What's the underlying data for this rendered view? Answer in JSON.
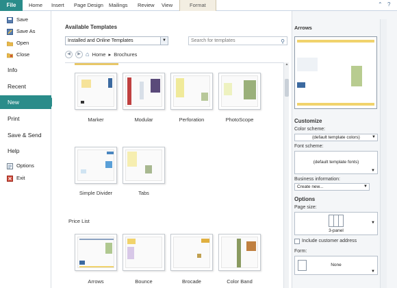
{
  "ribbon": {
    "file": "File",
    "tabs": [
      "Home",
      "Insert",
      "Page Design",
      "Mailings",
      "Review",
      "View"
    ],
    "format": "Format"
  },
  "backstage": {
    "items": [
      {
        "label": "Save",
        "icon": "save-icon"
      },
      {
        "label": "Save As",
        "icon": "save-as-icon"
      },
      {
        "label": "Open",
        "icon": "open-folder-icon"
      },
      {
        "label": "Close",
        "icon": "close-document-icon"
      }
    ],
    "sections": [
      "Info",
      "Recent",
      "New",
      "Print",
      "Save & Send",
      "Help"
    ],
    "active": "New",
    "bottom": [
      {
        "label": "Options",
        "icon": "options-icon"
      },
      {
        "label": "Exit",
        "icon": "exit-icon"
      }
    ]
  },
  "main": {
    "title": "Available Templates",
    "dropdown": "Installed and Online Templates",
    "search_placeholder": "Search for templates",
    "breadcrumb": {
      "home": "Home",
      "current": "Brochures"
    },
    "row1": [
      "Marker",
      "Modular",
      "Perforation",
      "PhotoScope"
    ],
    "row2": [
      "Simple Divider",
      "Tabs"
    ],
    "section": "Price List",
    "row3": [
      "Arrows",
      "Bounce",
      "Brocade",
      "Color Band"
    ]
  },
  "panel": {
    "title": "Arrows",
    "customize": "Customize",
    "color_scheme_label": "Color scheme:",
    "color_scheme": "(default template colors)",
    "font_scheme_label": "Font scheme:",
    "font_scheme": "(default template fonts)",
    "business_label": "Business information:",
    "business": "Create new...",
    "options": "Options",
    "page_size_label": "Page size:",
    "page_size": "3-panel",
    "include_address": "Include customer address",
    "form_label": "Form:",
    "form": "None"
  },
  "colors": {
    "accent": "#2a8c8a",
    "tile_yellow": "#f1d36c",
    "link_blue": "#4a6e94"
  }
}
